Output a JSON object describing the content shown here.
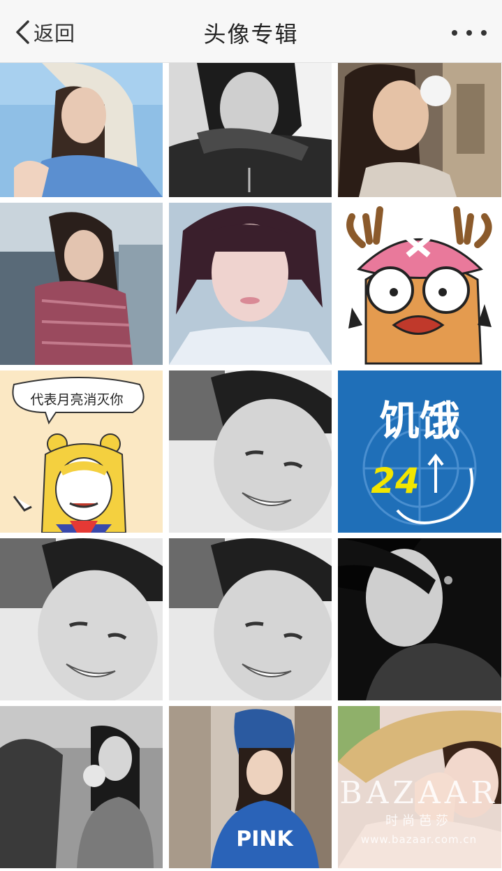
{
  "nav": {
    "back_label": "返回",
    "title": "头像专辑",
    "more_icon": "more-dots-icon"
  },
  "images": {
    "sticker_text": "代表月亮消灭你",
    "hunger_title": "饥饿",
    "hunger_number": "24",
    "pink_text": "PINK"
  },
  "watermark": {
    "brand": "BAZAAR",
    "sub": "时尚芭莎",
    "url": "www.bazaar.com.cn"
  }
}
